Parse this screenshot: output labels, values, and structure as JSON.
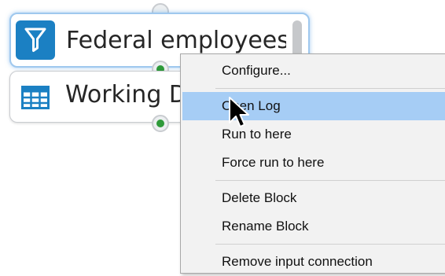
{
  "canvas": {
    "blocks": [
      {
        "title": "Federal employees",
        "icon": "filter-icon",
        "selected": true
      },
      {
        "title": "Working D",
        "icon": "table-icon",
        "selected": false
      }
    ]
  },
  "context_menu": {
    "groups": [
      [
        {
          "label": "Configure..."
        }
      ],
      [
        {
          "label": "Open Log"
        },
        {
          "label": "Run to here"
        },
        {
          "label": "Force run to here"
        }
      ],
      [
        {
          "label": "Delete Block"
        },
        {
          "label": "Rename Block"
        }
      ],
      [
        {
          "label": "Remove input connection"
        }
      ]
    ],
    "highlighted_label": "Open Log"
  },
  "colors": {
    "accent_blue": "#1b80c3",
    "selection_glow": "#9fc8ee",
    "menu_highlight": "#a6cdf5",
    "connector_green": "#2e9a3a"
  }
}
